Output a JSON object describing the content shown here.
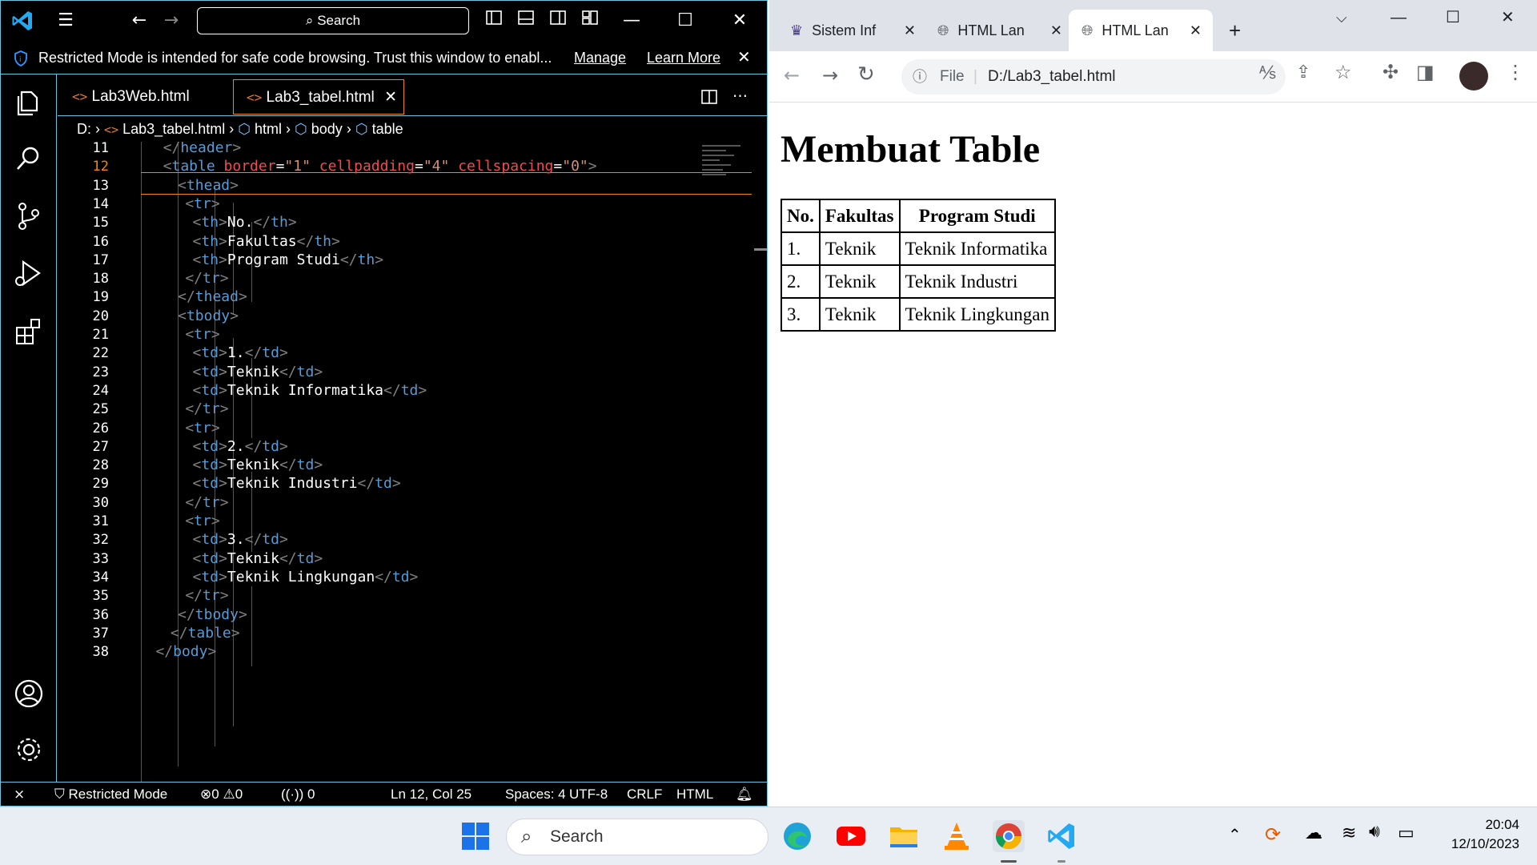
{
  "vscode": {
    "search_label": "Search",
    "banner": {
      "text": "Restricted Mode is intended for safe code browsing. Trust this window to enabl...",
      "manage": "Manage",
      "learn_more": "Learn More"
    },
    "tabs": [
      {
        "label": "Lab3Web.html",
        "active": false
      },
      {
        "label": "Lab3_tabel.html",
        "active": true
      }
    ],
    "breadcrumb": [
      "D:",
      "Lab3_tabel.html",
      "html",
      "body",
      "table"
    ],
    "code_lines": [
      {
        "n": "11",
        "text": "</header>"
      },
      {
        "n": "12",
        "text": "<table border=\"1\" cellpadding=\"4\" cellspacing=\"0\">"
      },
      {
        "n": "13",
        "text": "<thead>"
      },
      {
        "n": "14",
        "text": "<tr>"
      },
      {
        "n": "15",
        "text": "<th>No.</th>"
      },
      {
        "n": "16",
        "text": "<th>Fakultas</th>"
      },
      {
        "n": "17",
        "text": "<th>Program Studi</th>"
      },
      {
        "n": "18",
        "text": "</tr>"
      },
      {
        "n": "19",
        "text": "</thead>"
      },
      {
        "n": "20",
        "text": "<tbody>"
      },
      {
        "n": "21",
        "text": "<tr>"
      },
      {
        "n": "22",
        "text": "<td>1.</td>"
      },
      {
        "n": "23",
        "text": "<td>Teknik</td>"
      },
      {
        "n": "24",
        "text": "<td>Teknik Informatika</td>"
      },
      {
        "n": "25",
        "text": "</tr>"
      },
      {
        "n": "26",
        "text": "<tr>"
      },
      {
        "n": "27",
        "text": "<td>2.</td>"
      },
      {
        "n": "28",
        "text": "<td>Teknik</td>"
      },
      {
        "n": "29",
        "text": "<td>Teknik Industri</td>"
      },
      {
        "n": "30",
        "text": "</tr>"
      },
      {
        "n": "31",
        "text": "<tr>"
      },
      {
        "n": "32",
        "text": "<td>3.</td>"
      },
      {
        "n": "33",
        "text": "<td>Teknik</td>"
      },
      {
        "n": "34",
        "text": "<td>Teknik Lingkungan</td>"
      },
      {
        "n": "35",
        "text": "</tr>"
      },
      {
        "n": "36",
        "text": "</tbody>"
      },
      {
        "n": "37",
        "text": "</table>"
      },
      {
        "n": "38",
        "text": "</body>"
      }
    ],
    "status": {
      "restricted": "Restricted Mode",
      "errors": "0",
      "warnings": "0",
      "ports": "0",
      "position": "Ln 12, Col 25",
      "spaces": "Spaces: 4",
      "encoding": "UTF-8",
      "eol": "CRLF",
      "language": "HTML"
    }
  },
  "chrome": {
    "tabs": [
      {
        "label": "Sistem Inf"
      },
      {
        "label": "HTML Lan"
      },
      {
        "label": "HTML Lan"
      }
    ],
    "omnibox_prefix": "File",
    "url": "D:/Lab3_tabel.html",
    "page": {
      "heading": "Membuat Table",
      "table_headers": [
        "No.",
        "Fakultas",
        "Program Studi"
      ],
      "table_rows": [
        [
          "1.",
          "Teknik",
          "Teknik Informatika"
        ],
        [
          "2.",
          "Teknik",
          "Teknik Industri"
        ],
        [
          "3.",
          "Teknik",
          "Teknik Lingkungan"
        ]
      ]
    }
  },
  "taskbar": {
    "search_label": "Search",
    "time": "20:04",
    "date": "12/10/2023"
  },
  "colors": {
    "vscode_border": "#6fc3df",
    "tag": "#569cd6",
    "attribute": "#9cdcfe",
    "string": "#ce9178",
    "current_line_border": "#f38518"
  }
}
